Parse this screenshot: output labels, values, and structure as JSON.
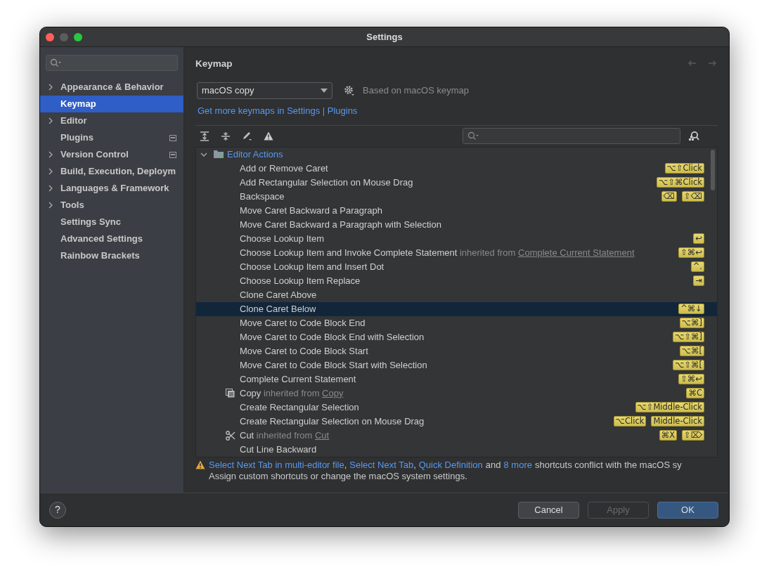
{
  "window": {
    "title": "Settings"
  },
  "sidebar": {
    "items": [
      {
        "label": "Appearance & Behavior",
        "expandable": true,
        "selected": false,
        "managed": false
      },
      {
        "label": "Keymap",
        "expandable": false,
        "selected": true,
        "managed": false
      },
      {
        "label": "Editor",
        "expandable": true,
        "selected": false,
        "managed": false
      },
      {
        "label": "Plugins",
        "expandable": false,
        "selected": false,
        "managed": true
      },
      {
        "label": "Version Control",
        "expandable": true,
        "selected": false,
        "managed": true
      },
      {
        "label": "Build, Execution, Deploym",
        "expandable": true,
        "selected": false,
        "managed": false
      },
      {
        "label": "Languages & Framework",
        "expandable": true,
        "selected": false,
        "managed": false
      },
      {
        "label": "Tools",
        "expandable": true,
        "selected": false,
        "managed": false
      },
      {
        "label": "Settings Sync",
        "expandable": false,
        "selected": false,
        "managed": false
      },
      {
        "label": "Advanced Settings",
        "expandable": false,
        "selected": false,
        "managed": false
      },
      {
        "label": "Rainbow Brackets",
        "expandable": false,
        "selected": false,
        "managed": false
      }
    ]
  },
  "page": {
    "title": "Keymap",
    "keymap": {
      "value": "macOS copy",
      "based_on": "Based on macOS keymap"
    },
    "link": "Get more keymaps in Settings | Plugins"
  },
  "tree": {
    "group": {
      "label": "Editor Actions",
      "expanded": true
    },
    "rows": [
      {
        "kind": "plain",
        "label": "Add or Remove Caret",
        "selected": false,
        "shortcuts": [
          "⌥⇧Click"
        ]
      },
      {
        "kind": "plain",
        "label": "Add Rectangular Selection on Mouse Drag",
        "selected": false,
        "shortcuts": [
          "⌥⇧⌘Click"
        ]
      },
      {
        "kind": "plain",
        "label": "Backspace",
        "selected": false,
        "shortcuts": [
          "⌫",
          "⇧⌫"
        ]
      },
      {
        "kind": "plain",
        "label": "Move Caret Backward a Paragraph",
        "selected": false,
        "shortcuts": []
      },
      {
        "kind": "plain",
        "label": "Move Caret Backward a Paragraph with Selection",
        "selected": false,
        "shortcuts": []
      },
      {
        "kind": "plain",
        "label": "Choose Lookup Item",
        "selected": false,
        "shortcuts": [
          "↩"
        ]
      },
      {
        "kind": "plain",
        "label": "Choose Lookup Item and Invoke Complete Statement",
        "selected": false,
        "inherited": {
          "prefix": "inherited from",
          "link": "Complete Current Statement"
        },
        "shortcuts": [
          "⇧⌘↩"
        ]
      },
      {
        "kind": "plain",
        "label": "Choose Lookup Item and Insert Dot",
        "selected": false,
        "shortcuts": [
          "^."
        ]
      },
      {
        "kind": "plain",
        "label": "Choose Lookup Item Replace",
        "selected": false,
        "shortcuts": [
          "⇥"
        ]
      },
      {
        "kind": "plain",
        "label": "Clone Caret Above",
        "selected": false,
        "shortcuts": []
      },
      {
        "kind": "plain",
        "label": "Clone Caret Below",
        "selected": true,
        "shortcuts": [
          "^⌘↓"
        ]
      },
      {
        "kind": "plain",
        "label": "Move Caret to Code Block End",
        "selected": false,
        "shortcuts": [
          "⌥⌘]"
        ]
      },
      {
        "kind": "plain",
        "label": "Move Caret to Code Block End with Selection",
        "selected": false,
        "shortcuts": [
          "⌥⇧⌘]"
        ]
      },
      {
        "kind": "plain",
        "label": "Move Caret to Code Block Start",
        "selected": false,
        "shortcuts": [
          "⌥⌘["
        ]
      },
      {
        "kind": "plain",
        "label": "Move Caret to Code Block Start with Selection",
        "selected": false,
        "shortcuts": [
          "⌥⇧⌘["
        ]
      },
      {
        "kind": "plain",
        "label": "Complete Current Statement",
        "selected": false,
        "shortcuts": [
          "⇧⌘↩"
        ]
      },
      {
        "kind": "copy",
        "label": "Copy",
        "selected": false,
        "inherited": {
          "prefix": "inherited from",
          "link": "Copy"
        },
        "shortcuts": [
          "⌘C"
        ]
      },
      {
        "kind": "plain",
        "label": "Create Rectangular Selection",
        "selected": false,
        "shortcuts": [
          "⌥⇧Middle-Click"
        ]
      },
      {
        "kind": "plain",
        "label": "Create Rectangular Selection on Mouse Drag",
        "selected": false,
        "shortcuts": [
          "⌥Click",
          "Middle-Click"
        ]
      },
      {
        "kind": "cut",
        "label": "Cut",
        "selected": false,
        "inherited": {
          "prefix": "inherited from",
          "link": "Cut"
        },
        "shortcuts": [
          "⌘X",
          "⇧⌦"
        ]
      },
      {
        "kind": "plain",
        "label": "Cut Line Backward",
        "selected": false,
        "shortcuts": []
      }
    ]
  },
  "warning": {
    "segments": [
      {
        "text": "Select Next Tab in multi-editor file",
        "link": true
      },
      {
        "text": ",",
        "link": false
      },
      {
        "text": "Select Next Tab",
        "link": true
      },
      {
        "text": ",",
        "link": false
      },
      {
        "text": "Quick Definition",
        "link": true
      },
      {
        "text": "and",
        "link": false
      },
      {
        "text": "8 more",
        "link": true
      },
      {
        "text": "shortcuts conflict with the macOS sy",
        "link": false
      }
    ],
    "note": "Assign custom shortcuts or change the macOS system settings."
  },
  "buttons": [
    {
      "label": "Cancel",
      "kind": "normal",
      "disabled": false
    },
    {
      "label": "Apply",
      "kind": "normal",
      "disabled": true
    },
    {
      "label": "OK",
      "kind": "default",
      "disabled": false
    }
  ],
  "help": "?"
}
